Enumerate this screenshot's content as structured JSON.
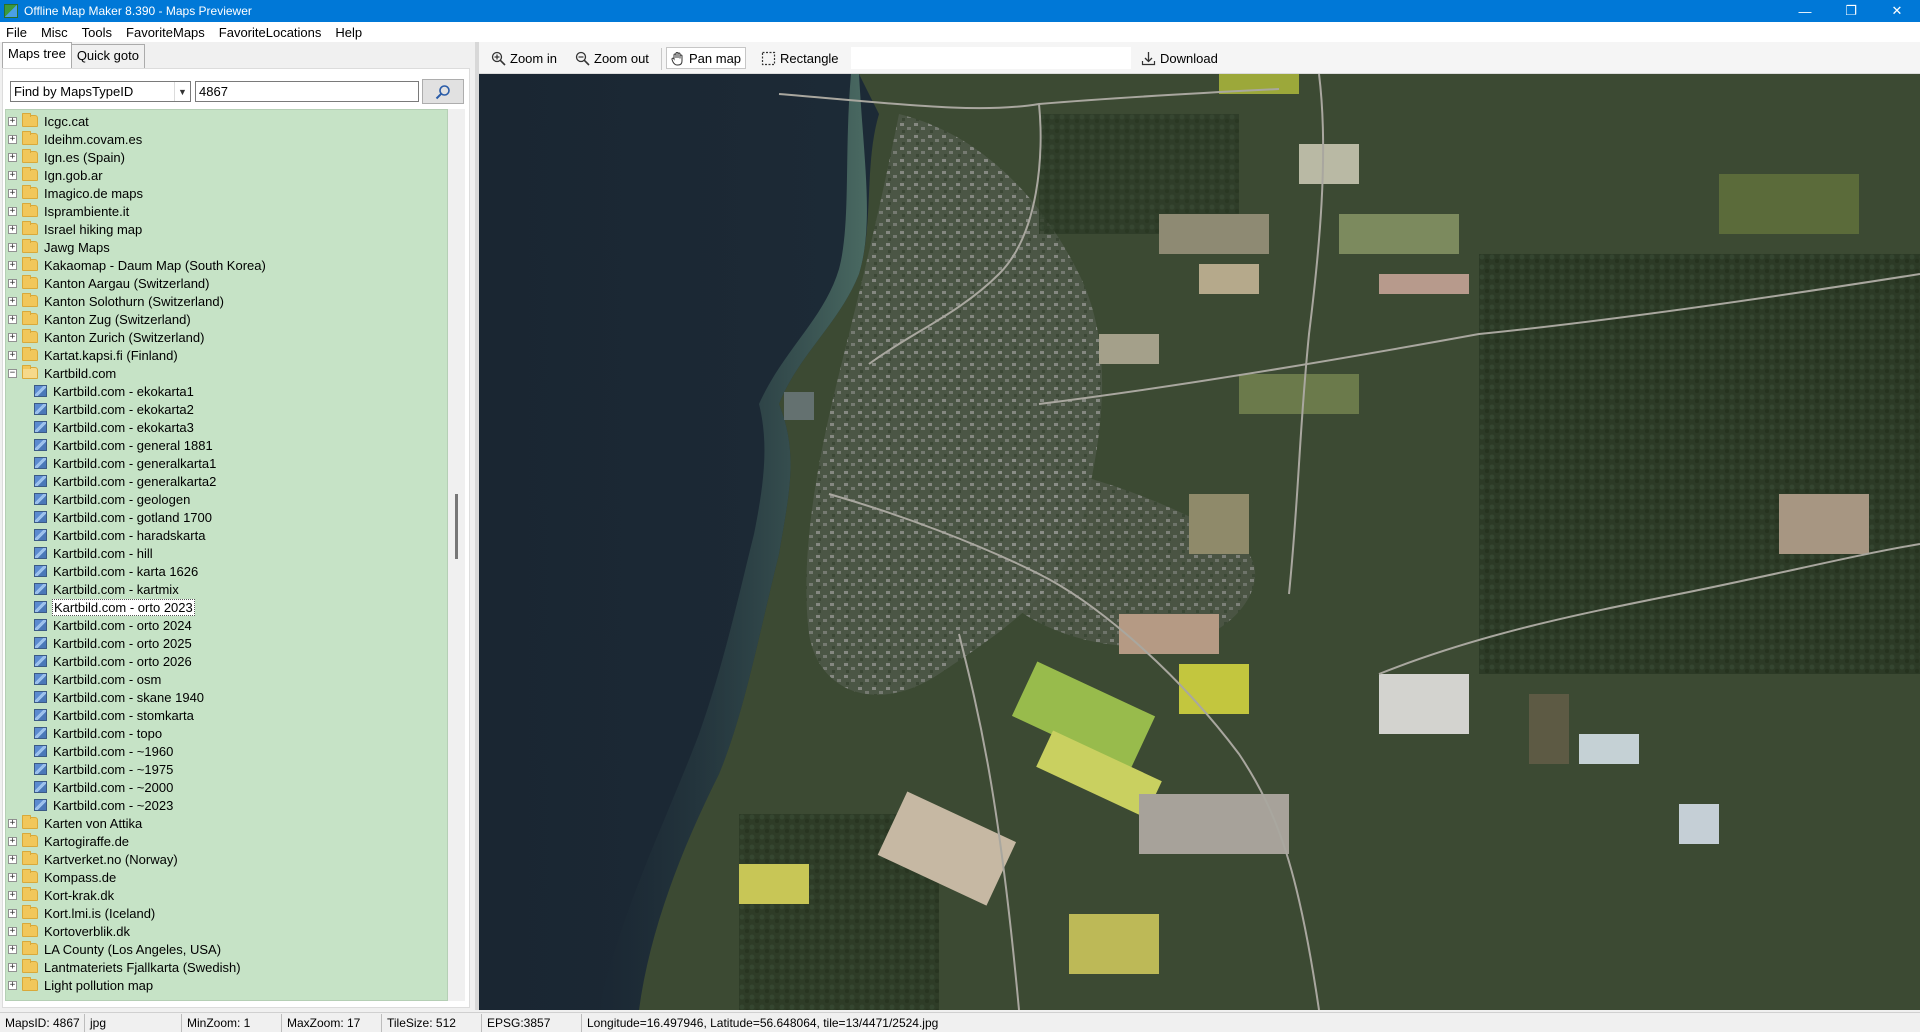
{
  "window": {
    "title": "Offline Map Maker 8.390 - Maps Previewer",
    "minimize": "—",
    "maximize": "❐",
    "close": "✕"
  },
  "menu": [
    "File",
    "Misc",
    "Tools",
    "FavoriteMaps",
    "FavoriteLocations",
    "Help"
  ],
  "left_panel": {
    "tabs": [
      "Maps tree",
      "Quick goto"
    ],
    "active_tab": "Maps tree",
    "find_by": "Find by MapsTypeID",
    "search_value": "4867",
    "tree": [
      {
        "label": "Icgc.cat",
        "type": "folder",
        "expander": "+"
      },
      {
        "label": "Ideihm.covam.es",
        "type": "folder",
        "expander": "+"
      },
      {
        "label": "Ign.es (Spain)",
        "type": "folder",
        "expander": "+"
      },
      {
        "label": "Ign.gob.ar",
        "type": "folder",
        "expander": "+"
      },
      {
        "label": "Imagico.de maps",
        "type": "folder",
        "expander": "+"
      },
      {
        "label": "Isprambiente.it",
        "type": "folder",
        "expander": "+"
      },
      {
        "label": "Israel hiking map",
        "type": "folder",
        "expander": "+"
      },
      {
        "label": "Jawg Maps",
        "type": "folder",
        "expander": "+"
      },
      {
        "label": "Kakaomap - Daum Map (South Korea)",
        "type": "folder",
        "expander": "+"
      },
      {
        "label": "Kanton Aargau (Switzerland)",
        "type": "folder",
        "expander": "+"
      },
      {
        "label": "Kanton Solothurn (Switzerland)",
        "type": "folder",
        "expander": "+"
      },
      {
        "label": "Kanton Zug (Switzerland)",
        "type": "folder",
        "expander": "+"
      },
      {
        "label": "Kanton Zurich (Switzerland)",
        "type": "folder",
        "expander": "+"
      },
      {
        "label": "Kartat.kapsi.fi (Finland)",
        "type": "folder",
        "expander": "+"
      },
      {
        "label": "Kartbild.com",
        "type": "folder-open",
        "expander": "−"
      },
      {
        "label": "Kartbild.com - ekokarta1",
        "type": "map"
      },
      {
        "label": "Kartbild.com - ekokarta2",
        "type": "map"
      },
      {
        "label": "Kartbild.com - ekokarta3",
        "type": "map"
      },
      {
        "label": "Kartbild.com - general 1881",
        "type": "map"
      },
      {
        "label": "Kartbild.com - generalkarta1",
        "type": "map"
      },
      {
        "label": "Kartbild.com - generalkarta2",
        "type": "map"
      },
      {
        "label": "Kartbild.com - geologen",
        "type": "map"
      },
      {
        "label": "Kartbild.com - gotland 1700",
        "type": "map"
      },
      {
        "label": "Kartbild.com - haradskarta",
        "type": "map"
      },
      {
        "label": "Kartbild.com - hill",
        "type": "map"
      },
      {
        "label": "Kartbild.com - karta 1626",
        "type": "map"
      },
      {
        "label": "Kartbild.com - kartmix",
        "type": "map"
      },
      {
        "label": "Kartbild.com - orto 2023",
        "type": "map",
        "selected": true
      },
      {
        "label": "Kartbild.com - orto 2024",
        "type": "map"
      },
      {
        "label": "Kartbild.com - orto 2025",
        "type": "map"
      },
      {
        "label": "Kartbild.com - orto 2026",
        "type": "map"
      },
      {
        "label": "Kartbild.com - osm",
        "type": "map"
      },
      {
        "label": "Kartbild.com - skane 1940",
        "type": "map"
      },
      {
        "label": "Kartbild.com - stomkarta",
        "type": "map"
      },
      {
        "label": "Kartbild.com - topo",
        "type": "map"
      },
      {
        "label": "Kartbild.com - ~1960",
        "type": "map"
      },
      {
        "label": "Kartbild.com - ~1975",
        "type": "map"
      },
      {
        "label": "Kartbild.com - ~2000",
        "type": "map"
      },
      {
        "label": "Kartbild.com - ~2023",
        "type": "map"
      },
      {
        "label": "Karten von Attika",
        "type": "folder",
        "expander": "+"
      },
      {
        "label": "Kartogiraffe.de",
        "type": "folder",
        "expander": "+"
      },
      {
        "label": "Kartverket.no (Norway)",
        "type": "folder",
        "expander": "+"
      },
      {
        "label": "Kompass.de",
        "type": "folder",
        "expander": "+"
      },
      {
        "label": "Kort-krak.dk",
        "type": "folder",
        "expander": "+"
      },
      {
        "label": "Kort.lmi.is (Iceland)",
        "type": "folder",
        "expander": "+"
      },
      {
        "label": "Kortoverblik.dk",
        "type": "folder",
        "expander": "+"
      },
      {
        "label": "LA County (Los Angeles, USA)",
        "type": "folder",
        "expander": "+"
      },
      {
        "label": "Lantmateriets Fjallkarta (Swedish)",
        "type": "folder",
        "expander": "+"
      },
      {
        "label": "Light pollution map",
        "type": "folder",
        "expander": "+"
      }
    ]
  },
  "toolbar": {
    "zoom_in": "Zoom in",
    "zoom_out": "Zoom out",
    "pan_map": "Pan map",
    "rectangle": "Rectangle",
    "download": "Download",
    "active_tool": "Pan map"
  },
  "statusbar": {
    "maps_id": "MapsID: 4867",
    "format": "jpg",
    "min_zoom": "MinZoom: 1",
    "max_zoom": "MaxZoom: 17",
    "tile_size": "TileSize: 512",
    "epsg": "EPSG:3857",
    "position": "Longitude=16.497946, Latitude=56.648064, tile=13/4471/2524.jpg"
  },
  "colors": {
    "titlebar": "#0078d7",
    "tree_background": "#c6e3c6",
    "water": "#1d2b37",
    "land": "#3c4a33"
  }
}
